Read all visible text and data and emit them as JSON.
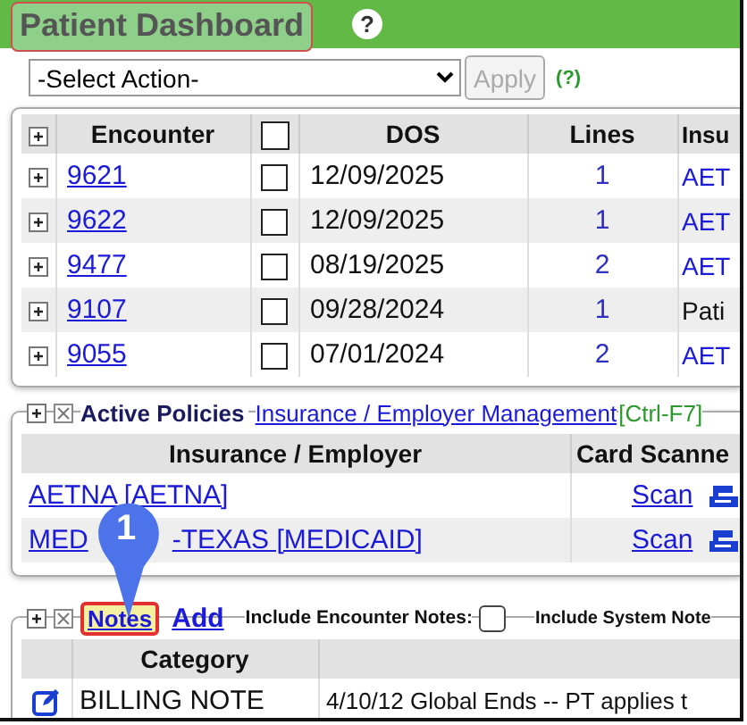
{
  "header": {
    "title": "Patient Dashboard",
    "help": "?"
  },
  "action_bar": {
    "select": "-Select Action-",
    "apply": "Apply",
    "apply_disabled": true,
    "help": "(?)"
  },
  "encounters": {
    "columns": [
      "Encounter",
      "DOS",
      "Lines",
      "Insu"
    ],
    "header_checked": false,
    "rows": [
      {
        "encounter": "9621",
        "checked": false,
        "dos": "12/09/2025",
        "lines": "1",
        "insurance": "AET",
        "link": true
      },
      {
        "encounter": "9622",
        "checked": false,
        "dos": "12/09/2025",
        "lines": "1",
        "insurance": "AET",
        "link": true
      },
      {
        "encounter": "9477",
        "checked": false,
        "dos": "08/19/2025",
        "lines": "2",
        "insurance": "AET",
        "link": true
      },
      {
        "encounter": "9107",
        "checked": false,
        "dos": "09/28/2024",
        "lines": "1",
        "insurance": "Pati",
        "link": false
      },
      {
        "encounter": "9055",
        "checked": false,
        "dos": "07/01/2024",
        "lines": "2",
        "insurance": "AET",
        "link": true
      }
    ]
  },
  "policies": {
    "title": "Active Policies",
    "link": "Insurance / Employer Management",
    "shortcut": "[Ctrl-F7]",
    "columns": [
      "Insurance / Employer",
      "Card Scanne"
    ],
    "rows": [
      {
        "insurance_parts": [
          "AETNA [AETNA]"
        ],
        "scan": "Scan"
      },
      {
        "insurance_parts": [
          "MED",
          "-TEXAS [MEDICAID]"
        ],
        "scan": "Scan"
      }
    ]
  },
  "notes": {
    "title": "Notes",
    "highlighted": true,
    "add": "Add",
    "include_encounter": {
      "label": "Include Encounter Notes:",
      "checked": false
    },
    "include_system": "Include System Note",
    "columns": [
      "Category"
    ],
    "rows": [
      {
        "category": "BILLING NOTE",
        "text": "4/10/12 Global Ends -- PT applies t"
      }
    ]
  },
  "marker": {
    "label": "1"
  }
}
